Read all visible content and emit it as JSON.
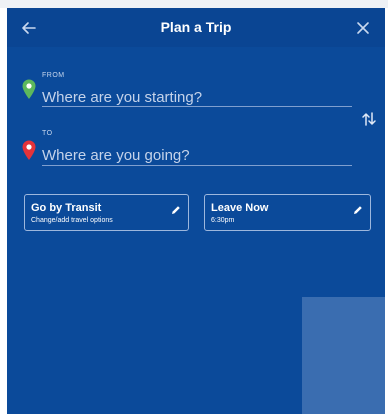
{
  "header": {
    "title": "Plan a Trip",
    "back_icon": "arrow-left-icon",
    "close_icon": "close-icon"
  },
  "from": {
    "label": "FROM",
    "placeholder": "Where are you starting?",
    "value": "",
    "pin_color": "#5cb85c"
  },
  "to": {
    "label": "TO",
    "placeholder": "Where are you going?",
    "value": "",
    "pin_color": "#e5333a"
  },
  "swap_icon": "swap-vertical-icon",
  "mode_option": {
    "title": "Go by Transit",
    "subtitle": "Change/add travel options",
    "icon": "pencil-icon"
  },
  "time_option": {
    "title": "Leave Now",
    "subtitle": "6:30pm",
    "icon": "pencil-icon"
  },
  "colors": {
    "panel_background": "#0b4a9a",
    "accent_square": "#3a6db0"
  }
}
